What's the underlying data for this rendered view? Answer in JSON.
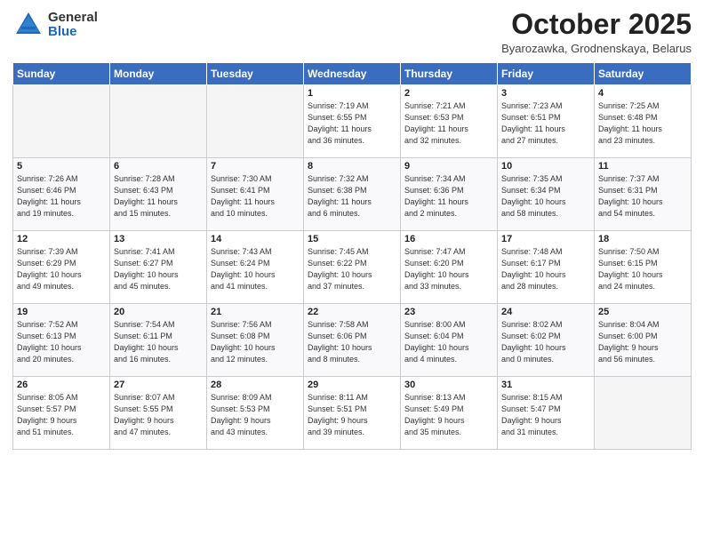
{
  "header": {
    "logo_general": "General",
    "logo_blue": "Blue",
    "title": "October 2025",
    "subtitle": "Byarozawka, Grodnenskaya, Belarus"
  },
  "weekdays": [
    "Sunday",
    "Monday",
    "Tuesday",
    "Wednesday",
    "Thursday",
    "Friday",
    "Saturday"
  ],
  "weeks": [
    [
      {
        "day": "",
        "detail": ""
      },
      {
        "day": "",
        "detail": ""
      },
      {
        "day": "",
        "detail": ""
      },
      {
        "day": "1",
        "detail": "Sunrise: 7:19 AM\nSunset: 6:55 PM\nDaylight: 11 hours\nand 36 minutes."
      },
      {
        "day": "2",
        "detail": "Sunrise: 7:21 AM\nSunset: 6:53 PM\nDaylight: 11 hours\nand 32 minutes."
      },
      {
        "day": "3",
        "detail": "Sunrise: 7:23 AM\nSunset: 6:51 PM\nDaylight: 11 hours\nand 27 minutes."
      },
      {
        "day": "4",
        "detail": "Sunrise: 7:25 AM\nSunset: 6:48 PM\nDaylight: 11 hours\nand 23 minutes."
      }
    ],
    [
      {
        "day": "5",
        "detail": "Sunrise: 7:26 AM\nSunset: 6:46 PM\nDaylight: 11 hours\nand 19 minutes."
      },
      {
        "day": "6",
        "detail": "Sunrise: 7:28 AM\nSunset: 6:43 PM\nDaylight: 11 hours\nand 15 minutes."
      },
      {
        "day": "7",
        "detail": "Sunrise: 7:30 AM\nSunset: 6:41 PM\nDaylight: 11 hours\nand 10 minutes."
      },
      {
        "day": "8",
        "detail": "Sunrise: 7:32 AM\nSunset: 6:38 PM\nDaylight: 11 hours\nand 6 minutes."
      },
      {
        "day": "9",
        "detail": "Sunrise: 7:34 AM\nSunset: 6:36 PM\nDaylight: 11 hours\nand 2 minutes."
      },
      {
        "day": "10",
        "detail": "Sunrise: 7:35 AM\nSunset: 6:34 PM\nDaylight: 10 hours\nand 58 minutes."
      },
      {
        "day": "11",
        "detail": "Sunrise: 7:37 AM\nSunset: 6:31 PM\nDaylight: 10 hours\nand 54 minutes."
      }
    ],
    [
      {
        "day": "12",
        "detail": "Sunrise: 7:39 AM\nSunset: 6:29 PM\nDaylight: 10 hours\nand 49 minutes."
      },
      {
        "day": "13",
        "detail": "Sunrise: 7:41 AM\nSunset: 6:27 PM\nDaylight: 10 hours\nand 45 minutes."
      },
      {
        "day": "14",
        "detail": "Sunrise: 7:43 AM\nSunset: 6:24 PM\nDaylight: 10 hours\nand 41 minutes."
      },
      {
        "day": "15",
        "detail": "Sunrise: 7:45 AM\nSunset: 6:22 PM\nDaylight: 10 hours\nand 37 minutes."
      },
      {
        "day": "16",
        "detail": "Sunrise: 7:47 AM\nSunset: 6:20 PM\nDaylight: 10 hours\nand 33 minutes."
      },
      {
        "day": "17",
        "detail": "Sunrise: 7:48 AM\nSunset: 6:17 PM\nDaylight: 10 hours\nand 28 minutes."
      },
      {
        "day": "18",
        "detail": "Sunrise: 7:50 AM\nSunset: 6:15 PM\nDaylight: 10 hours\nand 24 minutes."
      }
    ],
    [
      {
        "day": "19",
        "detail": "Sunrise: 7:52 AM\nSunset: 6:13 PM\nDaylight: 10 hours\nand 20 minutes."
      },
      {
        "day": "20",
        "detail": "Sunrise: 7:54 AM\nSunset: 6:11 PM\nDaylight: 10 hours\nand 16 minutes."
      },
      {
        "day": "21",
        "detail": "Sunrise: 7:56 AM\nSunset: 6:08 PM\nDaylight: 10 hours\nand 12 minutes."
      },
      {
        "day": "22",
        "detail": "Sunrise: 7:58 AM\nSunset: 6:06 PM\nDaylight: 10 hours\nand 8 minutes."
      },
      {
        "day": "23",
        "detail": "Sunrise: 8:00 AM\nSunset: 6:04 PM\nDaylight: 10 hours\nand 4 minutes."
      },
      {
        "day": "24",
        "detail": "Sunrise: 8:02 AM\nSunset: 6:02 PM\nDaylight: 10 hours\nand 0 minutes."
      },
      {
        "day": "25",
        "detail": "Sunrise: 8:04 AM\nSunset: 6:00 PM\nDaylight: 9 hours\nand 56 minutes."
      }
    ],
    [
      {
        "day": "26",
        "detail": "Sunrise: 8:05 AM\nSunset: 5:57 PM\nDaylight: 9 hours\nand 51 minutes."
      },
      {
        "day": "27",
        "detail": "Sunrise: 8:07 AM\nSunset: 5:55 PM\nDaylight: 9 hours\nand 47 minutes."
      },
      {
        "day": "28",
        "detail": "Sunrise: 8:09 AM\nSunset: 5:53 PM\nDaylight: 9 hours\nand 43 minutes."
      },
      {
        "day": "29",
        "detail": "Sunrise: 8:11 AM\nSunset: 5:51 PM\nDaylight: 9 hours\nand 39 minutes."
      },
      {
        "day": "30",
        "detail": "Sunrise: 8:13 AM\nSunset: 5:49 PM\nDaylight: 9 hours\nand 35 minutes."
      },
      {
        "day": "31",
        "detail": "Sunrise: 8:15 AM\nSunset: 5:47 PM\nDaylight: 9 hours\nand 31 minutes."
      },
      {
        "day": "",
        "detail": ""
      }
    ]
  ]
}
